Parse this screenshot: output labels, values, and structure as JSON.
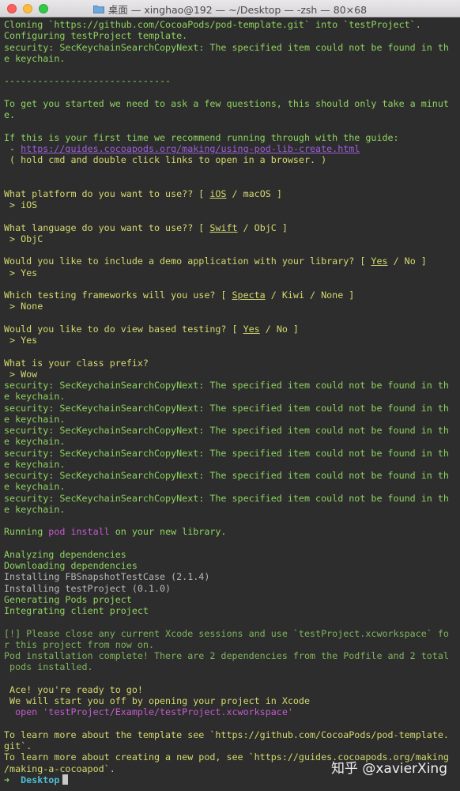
{
  "window": {
    "title": "桌面 — xinghao@192 — ~/Desktop — -zsh — 80×68"
  },
  "terminal": {
    "lines": [
      {
        "segments": [
          {
            "t": "Cloning `https://github.com/CocoaPods/pod-template.git` into `testProject`.",
            "c": "g"
          }
        ]
      },
      {
        "segments": [
          {
            "t": "Configuring testProject template.",
            "c": "g"
          }
        ]
      },
      {
        "segments": [
          {
            "t": "security: SecKeychainSearchCopyNext: The specified item could not be found in th",
            "c": "g"
          }
        ]
      },
      {
        "segments": [
          {
            "t": "e keychain.",
            "c": "g"
          }
        ]
      },
      {
        "segments": [
          {
            "t": "",
            "c": "g"
          }
        ]
      },
      {
        "segments": [
          {
            "t": "------------------------------",
            "c": "g"
          }
        ]
      },
      {
        "segments": [
          {
            "t": "",
            "c": "g"
          }
        ]
      },
      {
        "segments": [
          {
            "t": "To get you started we need to ask a few questions, this should only take a minut",
            "c": "g"
          }
        ]
      },
      {
        "segments": [
          {
            "t": "e.",
            "c": "g"
          }
        ]
      },
      {
        "segments": [
          {
            "t": "",
            "c": "g"
          }
        ]
      },
      {
        "segments": [
          {
            "t": "If this is your first time we recommend running through with the guide:",
            "c": "g"
          }
        ]
      },
      {
        "segments": [
          {
            "t": " - ",
            "c": "ye"
          },
          {
            "t": "https://guides.cocoapods.org/making/using-pod-lib-create.html",
            "c": "pu"
          }
        ]
      },
      {
        "segments": [
          {
            "t": " ( hold cmd and double click links to open in a browser. )",
            "c": "ye"
          }
        ]
      },
      {
        "segments": [
          {
            "t": "",
            "c": "g"
          }
        ]
      },
      {
        "segments": [
          {
            "t": "",
            "c": "g"
          }
        ]
      },
      {
        "segments": [
          {
            "t": "What platform do you want to use?? [ ",
            "c": "ye"
          },
          {
            "t": "iOS",
            "c": "ye u"
          },
          {
            "t": " / macOS ]",
            "c": "ye"
          }
        ]
      },
      {
        "segments": [
          {
            "t": " > iOS",
            "c": "ye"
          }
        ]
      },
      {
        "segments": [
          {
            "t": "",
            "c": "g"
          }
        ]
      },
      {
        "segments": [
          {
            "t": "What language do you want to use?? [ ",
            "c": "ye"
          },
          {
            "t": "Swift",
            "c": "ye u"
          },
          {
            "t": " / ObjC ]",
            "c": "ye"
          }
        ]
      },
      {
        "segments": [
          {
            "t": " > ObjC",
            "c": "ye"
          }
        ]
      },
      {
        "segments": [
          {
            "t": "",
            "c": "g"
          }
        ]
      },
      {
        "segments": [
          {
            "t": "Would you like to include a demo application with your library? [ ",
            "c": "ye"
          },
          {
            "t": "Yes",
            "c": "ye u"
          },
          {
            "t": " / No ]",
            "c": "ye"
          }
        ]
      },
      {
        "segments": [
          {
            "t": " > Yes",
            "c": "ye"
          }
        ]
      },
      {
        "segments": [
          {
            "t": "",
            "c": "g"
          }
        ]
      },
      {
        "segments": [
          {
            "t": "Which testing frameworks will you use? [ ",
            "c": "ye"
          },
          {
            "t": "Specta",
            "c": "ye u"
          },
          {
            "t": " / Kiwi / None ]",
            "c": "ye"
          }
        ]
      },
      {
        "segments": [
          {
            "t": " > None",
            "c": "ye"
          }
        ]
      },
      {
        "segments": [
          {
            "t": "",
            "c": "g"
          }
        ]
      },
      {
        "segments": [
          {
            "t": "Would you like to do view based testing? [ ",
            "c": "ye"
          },
          {
            "t": "Yes",
            "c": "ye u"
          },
          {
            "t": " / No ]",
            "c": "ye"
          }
        ]
      },
      {
        "segments": [
          {
            "t": " > Yes",
            "c": "ye"
          }
        ]
      },
      {
        "segments": [
          {
            "t": "",
            "c": "g"
          }
        ]
      },
      {
        "segments": [
          {
            "t": "What is your class prefix?",
            "c": "ye"
          }
        ]
      },
      {
        "segments": [
          {
            "t": " > Wow",
            "c": "ye"
          }
        ]
      },
      {
        "segments": [
          {
            "t": "security: SecKeychainSearchCopyNext: The specified item could not be found in th",
            "c": "g"
          }
        ]
      },
      {
        "segments": [
          {
            "t": "e keychain.",
            "c": "g"
          }
        ]
      },
      {
        "segments": [
          {
            "t": "security: SecKeychainSearchCopyNext: The specified item could not be found in th",
            "c": "g"
          }
        ]
      },
      {
        "segments": [
          {
            "t": "e keychain.",
            "c": "g"
          }
        ]
      },
      {
        "segments": [
          {
            "t": "security: SecKeychainSearchCopyNext: The specified item could not be found in th",
            "c": "g"
          }
        ]
      },
      {
        "segments": [
          {
            "t": "e keychain.",
            "c": "g"
          }
        ]
      },
      {
        "segments": [
          {
            "t": "security: SecKeychainSearchCopyNext: The specified item could not be found in th",
            "c": "g"
          }
        ]
      },
      {
        "segments": [
          {
            "t": "e keychain.",
            "c": "g"
          }
        ]
      },
      {
        "segments": [
          {
            "t": "security: SecKeychainSearchCopyNext: The specified item could not be found in th",
            "c": "g"
          }
        ]
      },
      {
        "segments": [
          {
            "t": "e keychain.",
            "c": "g"
          }
        ]
      },
      {
        "segments": [
          {
            "t": "security: SecKeychainSearchCopyNext: The specified item could not be found in th",
            "c": "g"
          }
        ]
      },
      {
        "segments": [
          {
            "t": "e keychain.",
            "c": "g"
          }
        ]
      },
      {
        "segments": [
          {
            "t": "",
            "c": "g"
          }
        ]
      },
      {
        "segments": [
          {
            "t": "Running ",
            "c": "g"
          },
          {
            "t": "pod install",
            "c": "mg"
          },
          {
            "t": " on your new library.",
            "c": "g"
          }
        ]
      },
      {
        "segments": [
          {
            "t": "",
            "c": "g"
          }
        ]
      },
      {
        "segments": [
          {
            "t": "Analyzing dependencies",
            "c": "g"
          }
        ]
      },
      {
        "segments": [
          {
            "t": "Downloading dependencies",
            "c": "g"
          }
        ]
      },
      {
        "segments": [
          {
            "t": "Installing FBSnapshotTestCase (2.1.4)",
            "c": "gr"
          }
        ]
      },
      {
        "segments": [
          {
            "t": "Installing testProject (0.1.0)",
            "c": "gr"
          }
        ]
      },
      {
        "segments": [
          {
            "t": "Generating Pods project",
            "c": "g"
          }
        ]
      },
      {
        "segments": [
          {
            "t": "Integrating client project",
            "c": "g"
          }
        ]
      },
      {
        "segments": [
          {
            "t": "",
            "c": "g"
          }
        ]
      },
      {
        "segments": [
          {
            "t": "[!] Please close any current Xcode sessions and use `testProject.xcworkspace` fo",
            "c": "gl"
          }
        ]
      },
      {
        "segments": [
          {
            "t": "r this project from now on.",
            "c": "gl"
          }
        ]
      },
      {
        "segments": [
          {
            "t": "Pod installation complete! There are 2 dependencies from the Podfile and 2 total",
            "c": "gl"
          }
        ]
      },
      {
        "segments": [
          {
            "t": " pods installed.",
            "c": "gl"
          }
        ]
      },
      {
        "segments": [
          {
            "t": "",
            "c": "g"
          }
        ]
      },
      {
        "segments": [
          {
            "t": " Ace! you're ready to go!",
            "c": "ye"
          }
        ]
      },
      {
        "segments": [
          {
            "t": " We will start you off by opening your project in Xcode",
            "c": "ye"
          }
        ]
      },
      {
        "segments": [
          {
            "t": "  open 'testProject/Example/testProject.xcworkspace'",
            "c": "mg"
          }
        ]
      },
      {
        "segments": [
          {
            "t": "",
            "c": "g"
          }
        ]
      },
      {
        "segments": [
          {
            "t": "To learn more about the template see `https://github.com/CocoaPods/pod-template.",
            "c": "ye"
          }
        ]
      },
      {
        "segments": [
          {
            "t": "git`.",
            "c": "ye"
          }
        ]
      },
      {
        "segments": [
          {
            "t": "To learn more about creating a new pod, see `https://guides.cocoapods.org/making",
            "c": "ye"
          }
        ]
      },
      {
        "segments": [
          {
            "t": "/making-a-cocoapod`.",
            "c": "ye"
          }
        ]
      }
    ],
    "prompt": {
      "arrow": "➜",
      "dir": "Desktop"
    }
  },
  "watermark": "知乎 @xavierXing"
}
